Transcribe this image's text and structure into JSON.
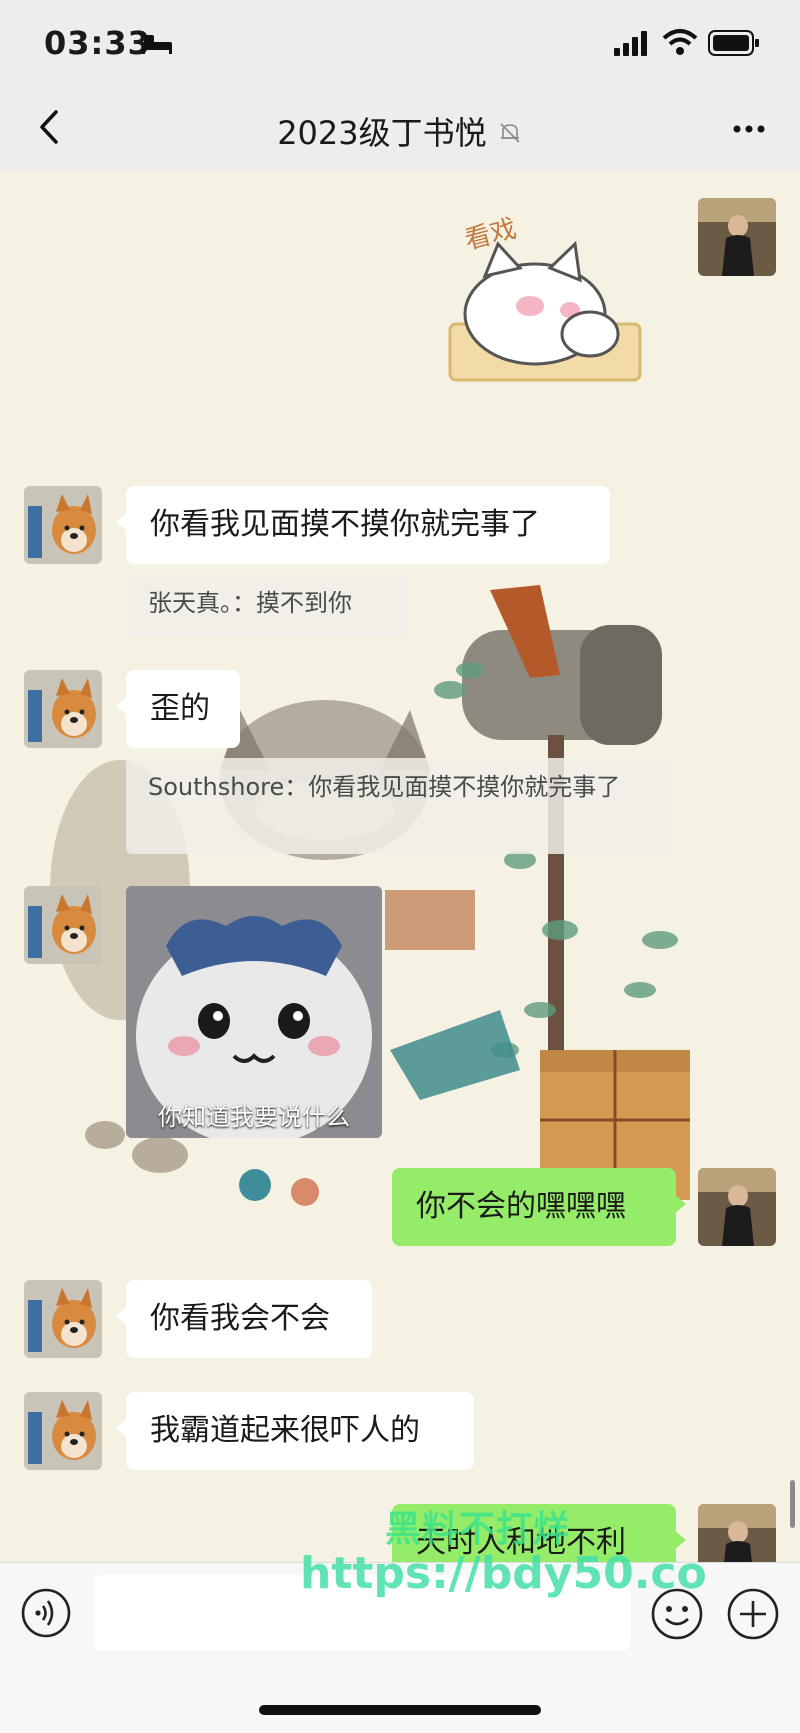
{
  "status_bar": {
    "time": "03:33",
    "icons": [
      "bed-icon",
      "signal-icon",
      "wifi-icon",
      "battery-icon"
    ]
  },
  "nav": {
    "title": "2023级丁书悦",
    "icons": [
      "back-icon",
      "mute-bell-icon",
      "more-icon"
    ]
  },
  "messages": [
    {
      "type": "sticker",
      "side": "out",
      "description_icon": "cat-sticker",
      "text": "看戏"
    },
    {
      "type": "text",
      "side": "in",
      "text": "你看我见面摸不摸你就完事了"
    },
    {
      "type": "quote",
      "text": "张天真。：摸不到你"
    },
    {
      "type": "text",
      "side": "in",
      "text": "歪的"
    },
    {
      "type": "quote",
      "text": "Southshore：你看我见面摸不摸你就完事了"
    },
    {
      "type": "sticker",
      "side": "in",
      "text": "你知道我要说什么"
    },
    {
      "type": "text",
      "side": "out",
      "text": "你不会的嘿嘿嘿"
    },
    {
      "type": "text",
      "side": "in",
      "text": "你看我会不会"
    },
    {
      "type": "text",
      "side": "in",
      "text": "我霸道起来很吓人的"
    },
    {
      "type": "text",
      "side": "out",
      "text": "天时人和地不利"
    }
  ],
  "watermark": {
    "line1": "黑料不打烊",
    "line2": "https://bdy50.co"
  },
  "input_bar": {
    "icons": [
      "voice-icon",
      "emoji-icon",
      "plus-icon"
    ]
  },
  "colors": {
    "chat_bg": "#f5f1e3",
    "bar_bg": "#ededed",
    "outgoing_bubble": "#95ec69",
    "incoming_bubble": "#ffffff"
  }
}
